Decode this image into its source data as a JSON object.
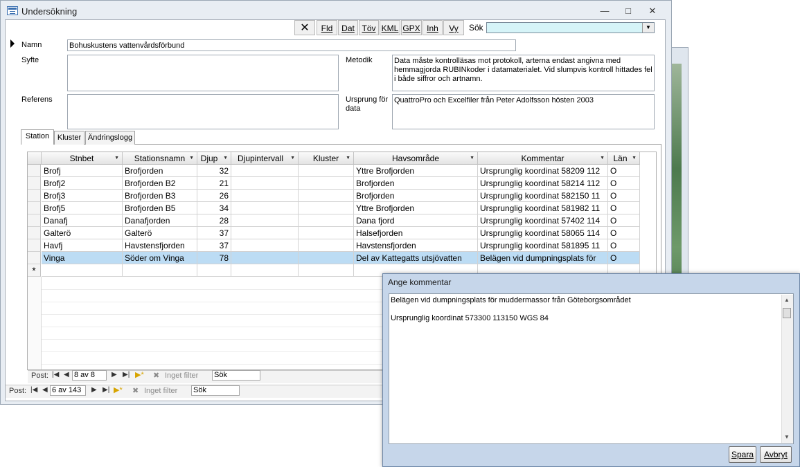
{
  "window": {
    "title": "Undersökning"
  },
  "toolbar": {
    "buttons": [
      "Fld",
      "Dat",
      "Töv",
      "KML",
      "GPX",
      "Inh",
      "Vy"
    ],
    "search_label": "Sök",
    "search_value": ""
  },
  "form": {
    "namn_label": "Namn",
    "namn_value": "Bohuskustens vattenvårdsförbund",
    "syfte_label": "Syfte",
    "syfte_value": "",
    "referens_label": "Referens",
    "referens_value": "",
    "metodik_label": "Metodik",
    "metodik_value": "Data måste kontrolläsas mot protokoll, arterna endast angivna med hemmagjorda RUBINkoder i datamaterialet. Vid slumpvis kontroll hittades fel i både siffror och artnamn.",
    "ursprung_label": "Ursprung för data",
    "ursprung_value": "QuattroPro och Excelfiler från Peter Adolfsson hösten 2003"
  },
  "tabs": [
    "Station",
    "Kluster",
    "Ändringslogg"
  ],
  "grid": {
    "columns": [
      "Stnbet",
      "Stationsnamn",
      "Djup",
      "Djupintervall",
      "Kluster",
      "Havsområde",
      "Kommentar",
      "Län"
    ],
    "rows": [
      [
        "Brofj",
        "Brofjorden",
        "32",
        "",
        "",
        "Yttre Brofjorden",
        "Ursprunglig koordinat 58209 112",
        "O"
      ],
      [
        "Brofj2",
        "Brofjorden B2",
        "21",
        "",
        "",
        "Brofjorden",
        "Ursprunglig koordinat 58214 112",
        "O"
      ],
      [
        "Brofj3",
        "Brofjorden B3",
        "26",
        "",
        "",
        "Brofjorden",
        "Ursprunglig koordinat 582150 11",
        "O"
      ],
      [
        "Brofj5",
        "Brofjorden B5",
        "34",
        "",
        "",
        "Yttre Brofjorden",
        "Ursprunglig koordinat 581982 11",
        "O"
      ],
      [
        "Danafj",
        "Danafjorden",
        "28",
        "",
        "",
        "Dana fjord",
        "Ursprunglig koordinat 57402 114",
        "O"
      ],
      [
        "Galterö",
        "Galterö",
        "37",
        "",
        "",
        "Halsefjorden",
        "Ursprunglig koordinat 58065 114",
        "O"
      ],
      [
        "Havfj",
        "Havstensfjorden",
        "37",
        "",
        "",
        "Havstensfjorden",
        "Ursprunglig koordinat 581895 11",
        "O"
      ],
      [
        "Vinga",
        "Söder om Vinga",
        "78",
        "",
        "",
        "Del av Kattegatts utsjövatten",
        "Belägen vid dumpningsplats för",
        "O"
      ]
    ],
    "new_row_marker": "*"
  },
  "subnav": {
    "label": "Post:",
    "record": "8 av 8",
    "filter": "Inget filter",
    "search": "Sök"
  },
  "mainnav": {
    "label": "Post:",
    "record": "6 av 143",
    "filter": "Inget filter",
    "search": "Sök"
  },
  "dialog": {
    "title": "Ange kommentar",
    "line1": "Belägen vid dumpningsplats för muddermassor från Göteborgsområdet",
    "line2": "Ursprunglig koordinat 573300 113150 WGS 84",
    "save_label": "Spara",
    "cancel_label": "Avbryt"
  }
}
